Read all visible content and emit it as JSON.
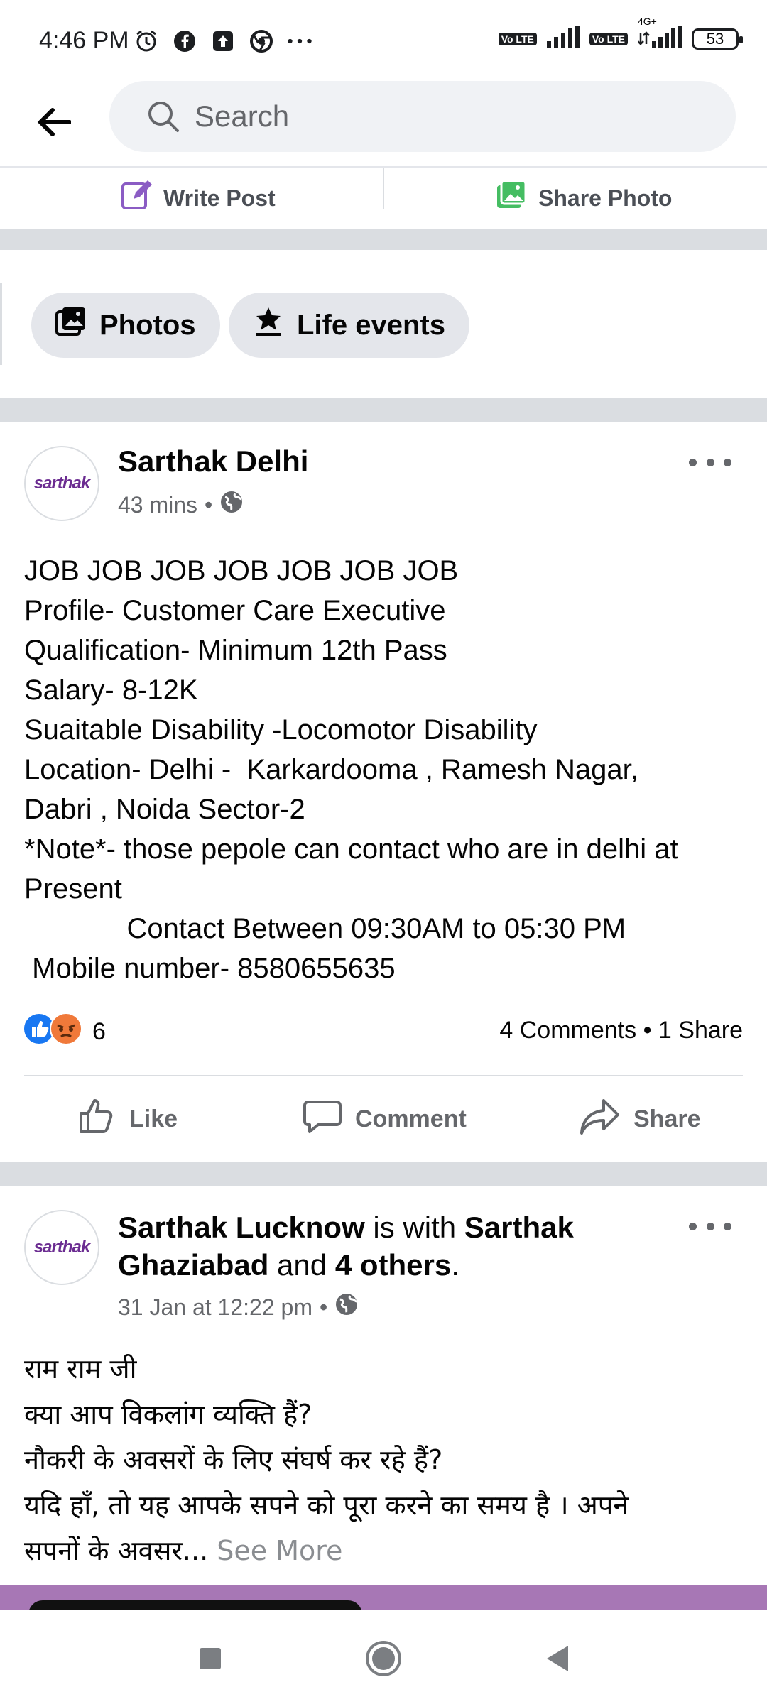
{
  "status_bar": {
    "time": "4:46 PM",
    "icons": [
      "alarm-icon",
      "facebook-icon",
      "upload-icon",
      "chrome-icon",
      "more-dots-icon"
    ],
    "signal_1_label": "Vo LTE",
    "signal_2_label": "Vo LTE",
    "network": "4G+",
    "battery": "53"
  },
  "search": {
    "placeholder": "Search"
  },
  "composer": {
    "write_post": "Write Post",
    "share_photo": "Share Photo"
  },
  "chips": {
    "photos": "Photos",
    "life_events": "Life events"
  },
  "post1": {
    "author": "Sarthak Delhi",
    "time": "43 mins",
    "separator": "•",
    "avatar_text": "sarthak",
    "body": "JOB JOB JOB JOB JOB JOB JOB\nProfile- Customer Care Executive\nQualification- Minimum 12th Pass\nSalary- 8-12K\nSuaitable Disability -Locomotor Disability\nLocation- Delhi -  Karkardooma , Ramesh Nagar,\nDabri , Noida Sector-2\n*Note*- those pepole can contact who are in delhi at\nPresent\n             Contact Between 09:30AM to 05:30 PM\n Mobile number- 8580655635",
    "reaction_count": "6",
    "comments_shares": "4 Comments • 1 Share",
    "like": "Like",
    "comment": "Comment",
    "share": "Share"
  },
  "post2": {
    "author": "Sarthak Lucknow",
    "with_text": " is with ",
    "tagged": "Sarthak Ghaziabad",
    "and_text": " and ",
    "others": "4 others",
    "period": ".",
    "time": "31 Jan at 12:22 pm",
    "separator": "•",
    "avatar_text": "sarthak",
    "body": "राम राम जी\nक्या आप विकलांग व्यक्ति हैं?\nनौकरी के अवसरों के लिए संघर्ष कर रहे हैं?\nयदि हाँ, तो यह आपके सपने को पूरा करने का समय है । अपने\nसपनों के अवसर...",
    "see_more": " See More"
  },
  "colors": {
    "accent_purple": "#6b2c91",
    "text_secondary": "#65676b",
    "separator_gray": "#dadde1",
    "like_blue": "#1877f2",
    "angry_orange": "#f0793a"
  }
}
